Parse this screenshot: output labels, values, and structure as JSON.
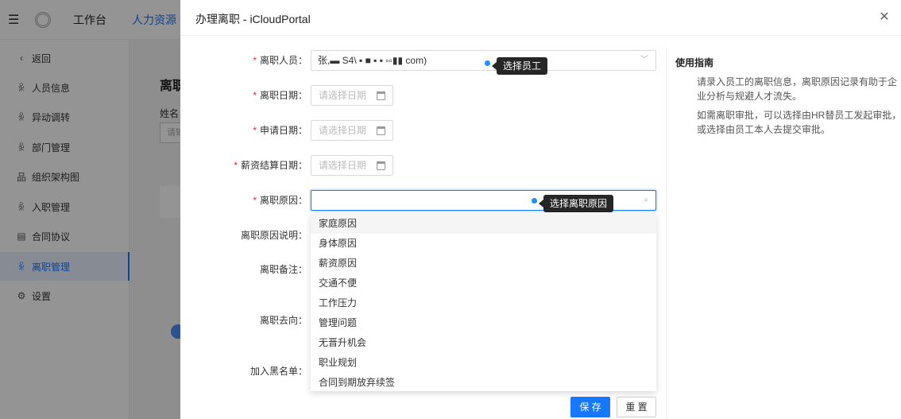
{
  "topbar": {
    "tabs": [
      {
        "label": "工作台"
      },
      {
        "label": "人力资源"
      }
    ]
  },
  "sidebar": {
    "items": [
      {
        "label": "返回",
        "icon": "‹"
      },
      {
        "label": "人员信息",
        "icon": "ꆜ"
      },
      {
        "label": "异动调转",
        "icon": "ꆜ"
      },
      {
        "label": "部门管理",
        "icon": "ꆜ"
      },
      {
        "label": "组织架构图",
        "icon": "品"
      },
      {
        "label": "入职管理",
        "icon": "ꆜ"
      },
      {
        "label": "合同协议",
        "icon": "▤"
      },
      {
        "label": "离职管理",
        "icon": "ꆜ"
      },
      {
        "label": "设置",
        "icon": "⚙"
      }
    ]
  },
  "content": {
    "title": "离职",
    "name_label": "姓名",
    "name_placeholder": "请输"
  },
  "drawer": {
    "title": "办理离职 - iCloudPortal",
    "close": "✕",
    "form": {
      "employee_label": "离职人员：",
      "employee_value": "张,▬   S4\\    ▪ ■ ▪  ▪ ▫▫▮▮  com)",
      "employee_tooltip": "选择员工",
      "leave_date_label": "离职日期：",
      "apply_date_label": "申请日期：",
      "salary_date_label": "薪资结算日期：",
      "date_placeholder": "请选择日期",
      "reason_label": "离职原因：",
      "reason_tooltip": "选择离职原因",
      "reason_desc_label": "离职原因说明：",
      "remark_label": "离职备注：",
      "destination_label": "离职去向：",
      "blacklist_label": "加入黑名单："
    },
    "reasons": [
      "家庭原因",
      "身体原因",
      "薪资原因",
      "交通不便",
      "工作压力",
      "管理问题",
      "无晋升机会",
      "职业规划",
      "合同到期放弃续签"
    ],
    "guide": {
      "title": "使用指南",
      "p1": "请录入员工的离职信息，离职原因记录有助于企业分析与规避人才流失。",
      "p2": "如需离职审批，可以选择由HR替员工发起审批，或选择由员工本人去提交审批。"
    },
    "buttons": {
      "save": "保 存",
      "reset": "重 置"
    }
  }
}
